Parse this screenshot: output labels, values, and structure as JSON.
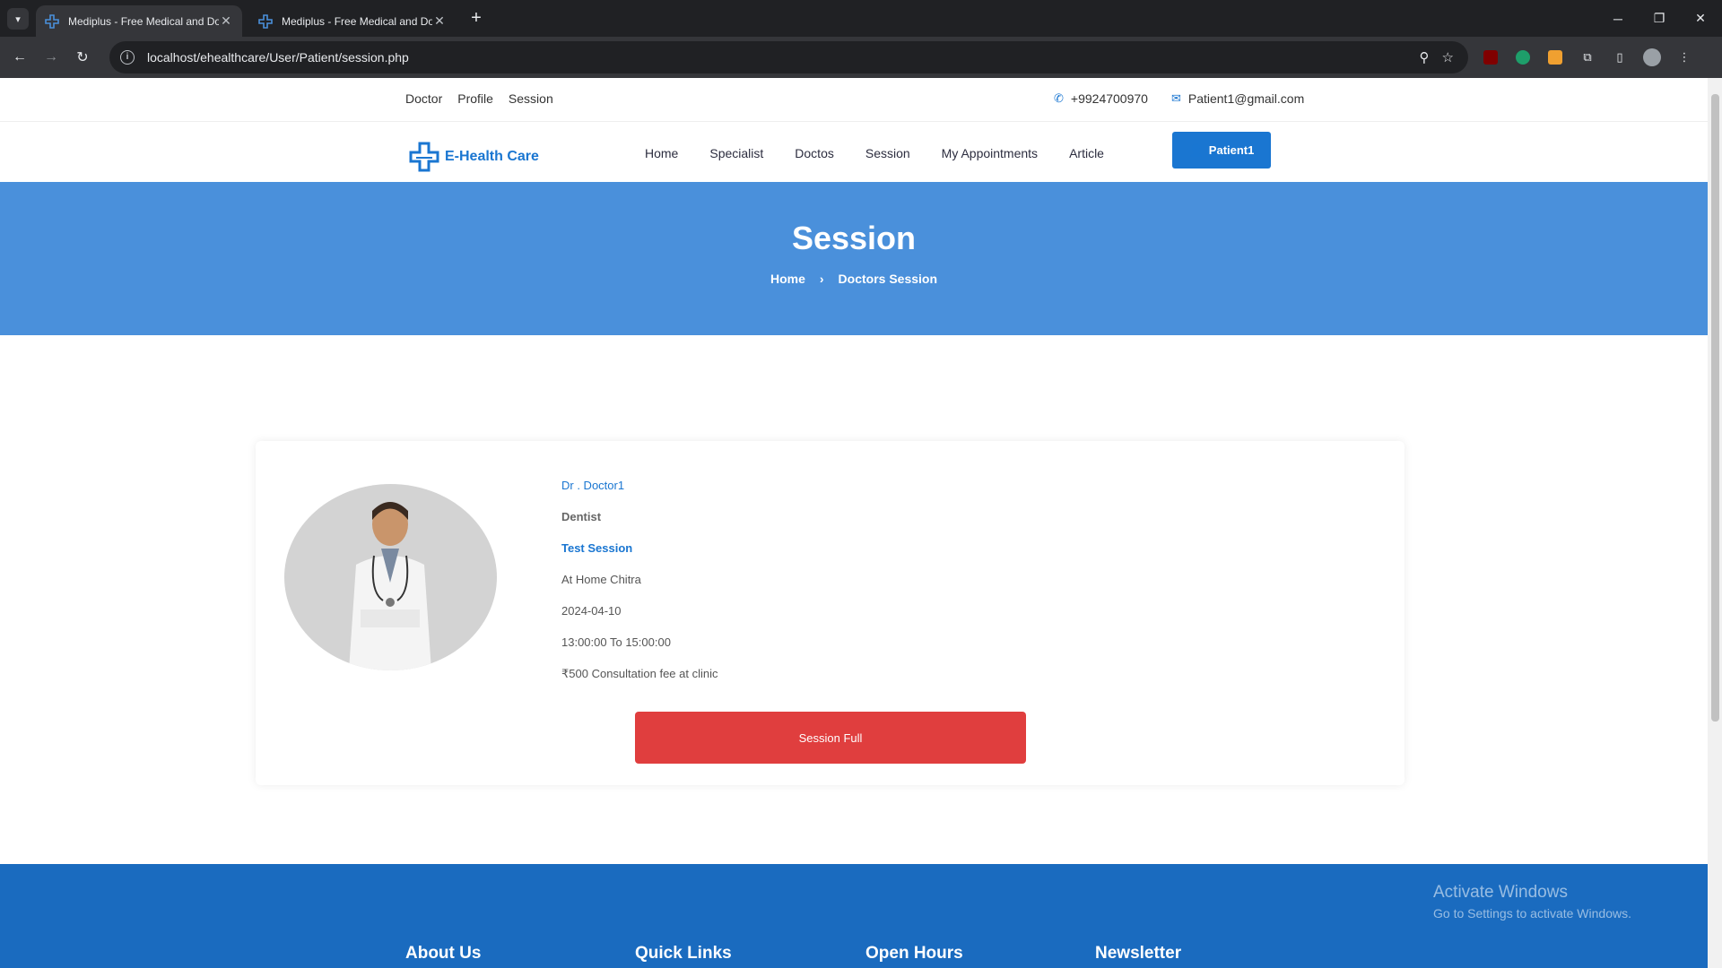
{
  "browser": {
    "tabs": [
      {
        "title": "Mediplus - Free Medical and Do"
      },
      {
        "title": "Mediplus - Free Medical and Do"
      }
    ],
    "url": "localhost/ehealthcare/User/Patient/session.php"
  },
  "topbar": {
    "links": [
      "Doctor",
      "Profile",
      "Session"
    ],
    "phone": "+9924700970",
    "email": "Patient1@gmail.com"
  },
  "nav": {
    "brand": "E-Health Care",
    "items": [
      "Home",
      "Specialist",
      "Doctos",
      "Session",
      "My Appointments",
      "Article"
    ],
    "user_button": "Patient1"
  },
  "hero": {
    "title": "Session",
    "breadcrumb_home": "Home",
    "breadcrumb_current": "Doctors Session"
  },
  "session": {
    "doctor": "Dr . Doctor1",
    "specialty": "Dentist",
    "session_name": "Test Session",
    "location": "At Home Chitra",
    "date": "2024-04-10",
    "time": "13:00:00 To 15:00:00",
    "fee": "₹500 Consultation fee at clinic",
    "status_button": "Session Full"
  },
  "footer": {
    "headings": [
      "About Us",
      "Quick Links",
      "Open Hours",
      "Newsletter"
    ]
  },
  "watermark": {
    "line1": "Activate Windows",
    "line2": "Go to Settings to activate Windows."
  },
  "colors": {
    "primary": "#1a76d1",
    "hero": "#4a90db",
    "danger": "#e03e3e",
    "footer": "#1a6bbf"
  }
}
